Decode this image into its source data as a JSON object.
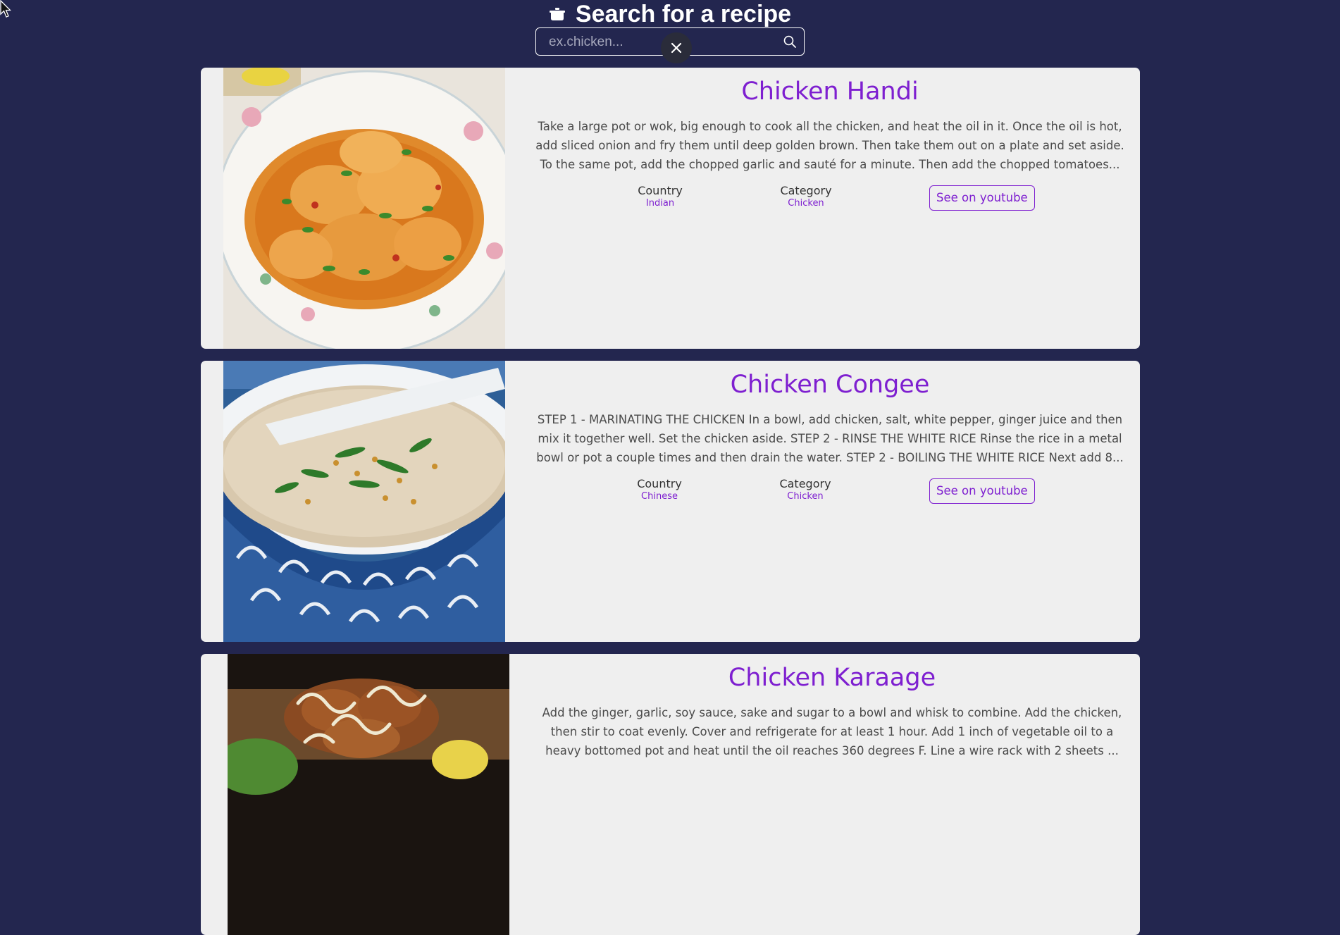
{
  "header": {
    "title": "Search for a recipe",
    "icon": "pot-icon",
    "search": {
      "placeholder": "ex.chicken...",
      "value": ""
    }
  },
  "recipes": [
    {
      "title": "Chicken Handi",
      "description": "Take a large pot or wok, big enough to cook all the chicken, and heat the oil in it. Once the oil is hot, add sliced onion and fry them until deep golden brown. Then take them out on a plate and set aside. To the same pot, add the chopped garlic and sauté for a minute. Then add the chopped tomatoes...",
      "country_label": "Country",
      "country": "Indian",
      "category_label": "Category",
      "category": "Chicken",
      "youtube_label": "See on youtube",
      "image": "chicken-handi-photo"
    },
    {
      "title": "Chicken Congee",
      "description": "STEP 1 - MARINATING THE CHICKEN In a bowl, add chicken, salt, white pepper, ginger juice and then mix it together well. Set the chicken aside. STEP 2 - RINSE THE WHITE RICE Rinse the rice in a metal bowl or pot a couple times and then drain the water. STEP 2 - BOILING THE WHITE RICE Next add 8...",
      "country_label": "Country",
      "country": "Chinese",
      "category_label": "Category",
      "category": "Chicken",
      "youtube_label": "See on youtube",
      "image": "chicken-congee-photo"
    },
    {
      "title": "Chicken Karaage",
      "description": "Add the ginger, garlic, soy sauce, sake and sugar to a bowl and whisk to combine. Add the chicken, then stir to coat evenly. Cover and refrigerate for at least 1 hour. Add 1 inch of vegetable oil to a heavy bottomed pot and heat until the oil reaches 360 degrees F. Line a wire rack with 2 sheets ...",
      "image": "chicken-karaage-photo"
    }
  ],
  "colors": {
    "background": "#23264f",
    "card": "#efefef",
    "accent": "#7e1fd0",
    "text": "#4b4b4b"
  }
}
